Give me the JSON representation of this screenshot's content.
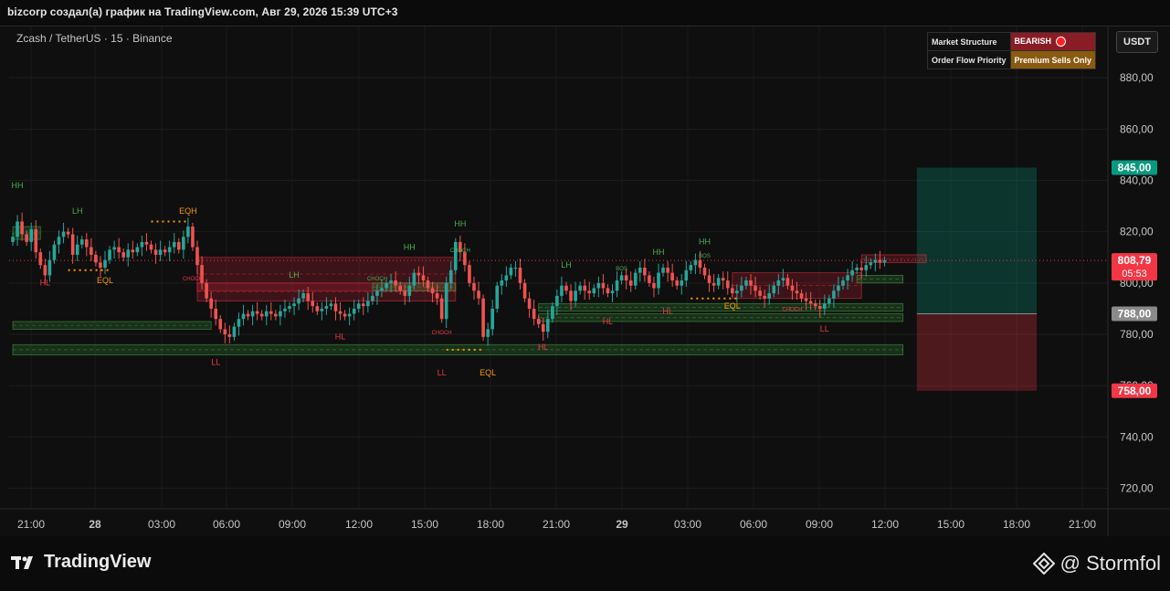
{
  "caption": "bizcorp создал(а) график на TradingView.com, Авг 29, 2026 15:39 UTC+3",
  "symbol": "Zcash / TetherUS · 15 · Binance",
  "currency_button": "USDT",
  "status": {
    "row1_label": "Market Structure",
    "row1_value": "BEARISH",
    "row2_label": "Order Flow Priority",
    "row2_value": "Premium Sells Only"
  },
  "footer": {
    "logo": "TradingView",
    "author": "@ Stormfol"
  },
  "colors": {
    "up": "#26a69a",
    "down": "#ef5350",
    "eq": "#ff9800",
    "structure_green": "#4caf50",
    "structure_red": "#f23645"
  },
  "chart_data": {
    "type": "candlestick",
    "x_ticks": [
      "21:00",
      "28",
      "03:00",
      "06:00",
      "09:00",
      "12:00",
      "15:00",
      "18:00",
      "21:00",
      "29",
      "03:00",
      "06:00",
      "09:00",
      "12:00",
      "15:00",
      "18:00",
      "21:00"
    ],
    "y_ticks": [
      "880,00",
      "860,00",
      "840,00",
      "820,00",
      "800,00",
      "780,00",
      "760,00",
      "740,00",
      "720,00"
    ],
    "ylim": [
      712,
      900
    ],
    "price_tags": [
      {
        "label": "845,00",
        "value": 845,
        "color": "#089981"
      },
      {
        "label": "808,79",
        "sublabel": "05:53",
        "value": 808.79,
        "color": "#f23645"
      },
      {
        "label": "788,00",
        "value": 788,
        "color": "#8a8a8a"
      },
      {
        "label": "758,00",
        "value": 758,
        "color": "#f23645"
      }
    ],
    "current_price": 808.79,
    "position": {
      "entry": 788,
      "target": 845,
      "stop": 758,
      "start_index": 196,
      "end_index": 222
    },
    "markers": [
      {
        "text": "HH",
        "i": 1,
        "value": 837,
        "color": "#4caf50"
      },
      {
        "text": "LH",
        "i": 14,
        "value": 827,
        "color": "#4caf50"
      },
      {
        "text": "EQH",
        "i": 38,
        "value": 827,
        "color": "#ff9800"
      },
      {
        "text": "HL",
        "i": 7,
        "value": 799,
        "color": "#f23645"
      },
      {
        "text": "EQL",
        "i": 20,
        "value": 800,
        "color": "#ff9800"
      },
      {
        "text": "LL",
        "i": 44,
        "value": 768,
        "color": "#f23645"
      },
      {
        "text": "LH",
        "i": 61,
        "value": 802,
        "color": "#4caf50"
      },
      {
        "text": "HL",
        "i": 71,
        "value": 778,
        "color": "#f23645"
      },
      {
        "text": "HH",
        "i": 86,
        "value": 813,
        "color": "#4caf50"
      },
      {
        "text": "LL",
        "i": 93,
        "value": 764,
        "color": "#f23645"
      },
      {
        "text": "HH",
        "i": 97,
        "value": 822,
        "color": "#4caf50"
      },
      {
        "text": "EQL",
        "i": 103,
        "value": 764,
        "color": "#ff9800"
      },
      {
        "text": "HL",
        "i": 115,
        "value": 774,
        "color": "#f23645"
      },
      {
        "text": "LH",
        "i": 120,
        "value": 806,
        "color": "#4caf50"
      },
      {
        "text": "HL",
        "i": 129,
        "value": 784,
        "color": "#f23645"
      },
      {
        "text": "HH",
        "i": 140,
        "value": 811,
        "color": "#4caf50"
      },
      {
        "text": "HL",
        "i": 142,
        "value": 788,
        "color": "#f23645"
      },
      {
        "text": "HH",
        "i": 150,
        "value": 815,
        "color": "#4caf50"
      },
      {
        "text": "EQL",
        "i": 156,
        "value": 790,
        "color": "#ff9800"
      },
      {
        "text": "LL",
        "i": 176,
        "value": 781,
        "color": "#f23645"
      }
    ],
    "small_labels": [
      {
        "text": "CHOCH",
        "i": 79,
        "value": 801,
        "color": "#4caf50"
      },
      {
        "text": "CHOCH",
        "i": 93,
        "value": 780,
        "color": "#f23645"
      },
      {
        "text": "CHOCH",
        "i": 97,
        "value": 812,
        "color": "#4caf50"
      },
      {
        "text": "CHOCH",
        "i": 39,
        "value": 801,
        "color": "#f23645"
      },
      {
        "text": "BOS",
        "i": 132,
        "value": 805,
        "color": "#4caf50"
      },
      {
        "text": "BOS",
        "i": 150,
        "value": 810,
        "color": "#4caf50"
      },
      {
        "text": "CHOCH",
        "i": 169,
        "value": 789,
        "color": "#f23645"
      }
    ],
    "zones": [
      {
        "from": 40,
        "to": 96,
        "top": 810,
        "bottom": 797,
        "kind": "supply"
      },
      {
        "from": 40,
        "to": 96,
        "top": 800,
        "bottom": 793,
        "kind": "supply"
      },
      {
        "from": 0,
        "to": 43,
        "top": 785,
        "bottom": 782,
        "kind": "demand"
      },
      {
        "from": 0,
        "to": 193,
        "top": 776,
        "bottom": 772,
        "kind": "demand"
      },
      {
        "from": 0,
        "to": 6,
        "top": 822,
        "bottom": 817,
        "kind": "demand"
      },
      {
        "from": 78,
        "to": 96,
        "top": 800,
        "bottom": 797,
        "kind": "demand"
      },
      {
        "from": 114,
        "to": 193,
        "top": 788,
        "bottom": 785,
        "kind": "demand"
      },
      {
        "from": 156,
        "to": 184,
        "top": 804,
        "bottom": 794,
        "kind": "supply"
      },
      {
        "from": 183,
        "to": 193,
        "top": 803,
        "bottom": 800,
        "kind": "demand"
      },
      {
        "from": 114,
        "to": 193,
        "top": 792,
        "bottom": 789,
        "kind": "demand"
      },
      {
        "from": 184,
        "to": 198,
        "top": 811,
        "bottom": 808,
        "kind": "supply"
      }
    ],
    "eq_lines": [
      {
        "from": 12,
        "to": 21,
        "value": 805
      },
      {
        "from": 30,
        "to": 38,
        "value": 824
      },
      {
        "from": 94,
        "to": 102,
        "value": 774
      },
      {
        "from": 147,
        "to": 157,
        "value": 794
      }
    ],
    "closes": [
      818,
      824,
      819,
      816,
      821,
      812,
      807,
      803,
      809,
      815,
      818,
      820,
      819,
      811,
      815,
      817,
      814,
      811,
      808,
      806,
      809,
      813,
      814,
      812,
      810,
      813,
      812,
      814,
      816,
      815,
      813,
      811,
      813,
      812,
      814,
      816,
      813,
      818,
      822,
      814,
      807,
      800,
      794,
      790,
      786,
      782,
      780,
      779,
      783,
      786,
      788,
      787,
      789,
      788,
      787,
      789,
      788,
      787,
      789,
      790,
      791,
      792,
      794,
      796,
      793,
      791,
      789,
      790,
      791,
      792,
      789,
      788,
      787,
      788,
      790,
      792,
      791,
      793,
      795,
      797,
      798,
      800,
      801,
      799,
      797,
      795,
      799,
      804,
      803,
      801,
      798,
      796,
      794,
      786,
      800,
      805,
      816,
      812,
      807,
      800,
      797,
      794,
      779,
      782,
      790,
      799,
      801,
      803,
      806,
      806,
      800,
      794,
      790,
      786,
      784,
      781,
      786,
      791,
      795,
      799,
      797,
      793,
      797,
      799,
      797,
      796,
      798,
      800,
      798,
      796,
      797,
      801,
      803,
      801,
      799,
      804,
      806,
      803,
      800,
      798,
      804,
      806,
      804,
      801,
      799,
      801,
      805,
      807,
      809,
      806,
      803,
      800,
      799,
      802,
      801,
      798,
      796,
      797,
      799,
      801,
      799,
      797,
      795,
      794,
      796,
      799,
      801,
      802,
      799,
      797,
      796,
      794,
      793,
      792,
      791,
      790,
      792,
      794,
      797,
      799,
      801,
      803,
      805,
      806,
      805,
      807,
      808,
      809,
      808,
      808.79
    ]
  }
}
